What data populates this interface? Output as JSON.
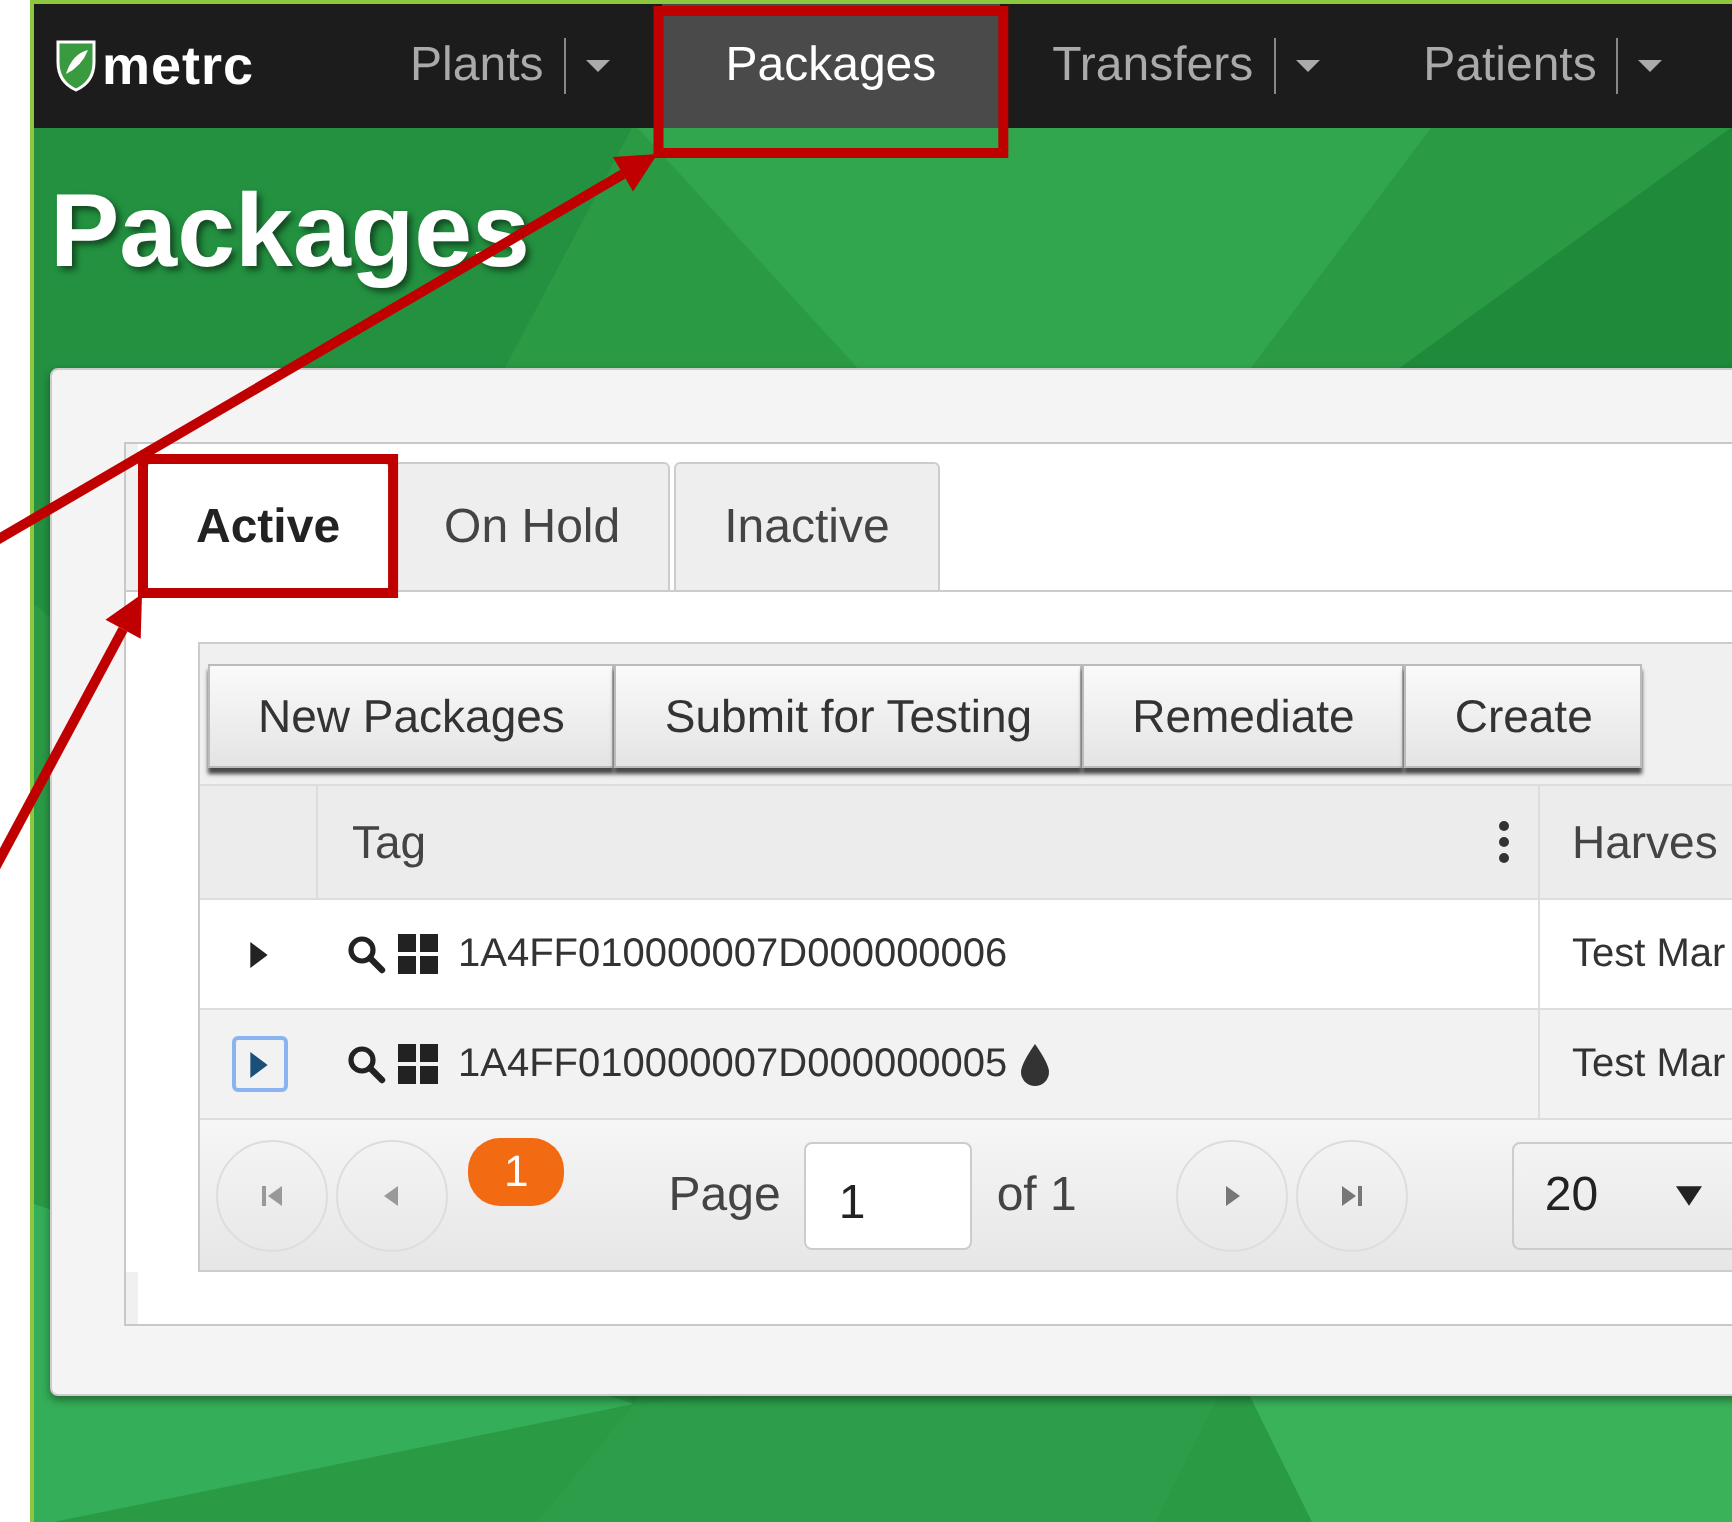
{
  "nav": {
    "logo": "metrc",
    "items": [
      {
        "label": "Plants",
        "has_dropdown": true,
        "selected": false,
        "highlighted": false
      },
      {
        "label": "Packages",
        "has_dropdown": false,
        "selected": true,
        "highlighted": true
      },
      {
        "label": "Transfers",
        "has_dropdown": true,
        "selected": false,
        "highlighted": false
      },
      {
        "label": "Patients",
        "has_dropdown": true,
        "selected": false,
        "highlighted": false
      }
    ]
  },
  "page_title": "Packages",
  "tabs": [
    {
      "label": "Active",
      "selected": true,
      "highlighted": true
    },
    {
      "label": "On Hold",
      "selected": false,
      "highlighted": false
    },
    {
      "label": "Inactive",
      "selected": false,
      "highlighted": false
    }
  ],
  "toolbar": [
    "New Packages",
    "Submit for Testing",
    "Remediate",
    "Create"
  ],
  "table": {
    "columns": [
      "",
      "Tag",
      "Harves"
    ],
    "rows": [
      {
        "tag": "1A4FF010000007D000000006",
        "column_3": "Test Mar",
        "has_drop": false,
        "focused": false
      },
      {
        "tag": "1A4FF010000007D000000005",
        "column_3": "Test Mar",
        "has_drop": true,
        "focused": true
      }
    ]
  },
  "pager": {
    "current": "1",
    "page_label": "Page",
    "page_value": "1",
    "of_label": "of 1",
    "page_size": "20"
  }
}
